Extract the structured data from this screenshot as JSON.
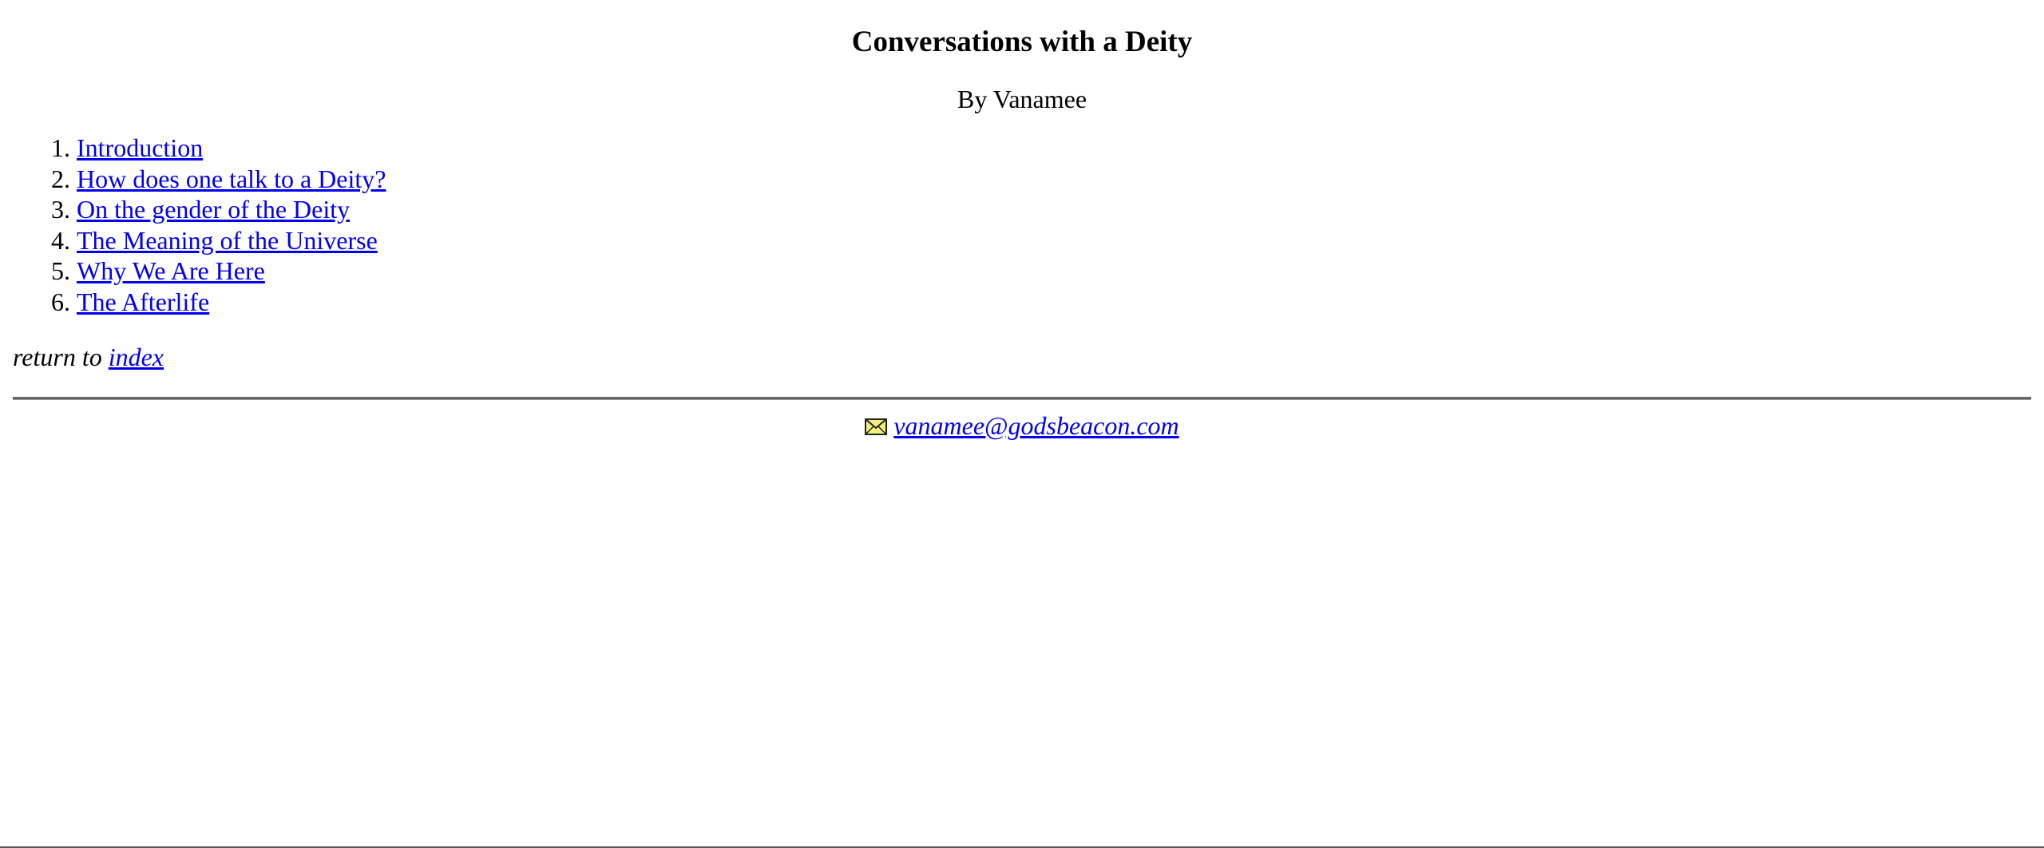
{
  "title": "Conversations with a Deity",
  "byline": "By Vanamee",
  "toc": [
    {
      "number": "1.",
      "label": "Introduction"
    },
    {
      "number": "2.",
      "label": "How does one talk to a Deity?"
    },
    {
      "number": "3.",
      "label": "On the gender of the Deity"
    },
    {
      "number": "4.",
      "label": "The Meaning of the Universe"
    },
    {
      "number": "5.",
      "label": "Why We Are Here"
    },
    {
      "number": "6.",
      "label": "The Afterlife"
    }
  ],
  "return": {
    "prefix": "return to",
    "link_label": "index"
  },
  "contact": {
    "icon": "mail-icon",
    "email": "vanamee@godsbeacon.com"
  },
  "colors": {
    "link": "#0000ee",
    "text": "#000000",
    "background": "#ffffff",
    "rule": "#666666"
  }
}
